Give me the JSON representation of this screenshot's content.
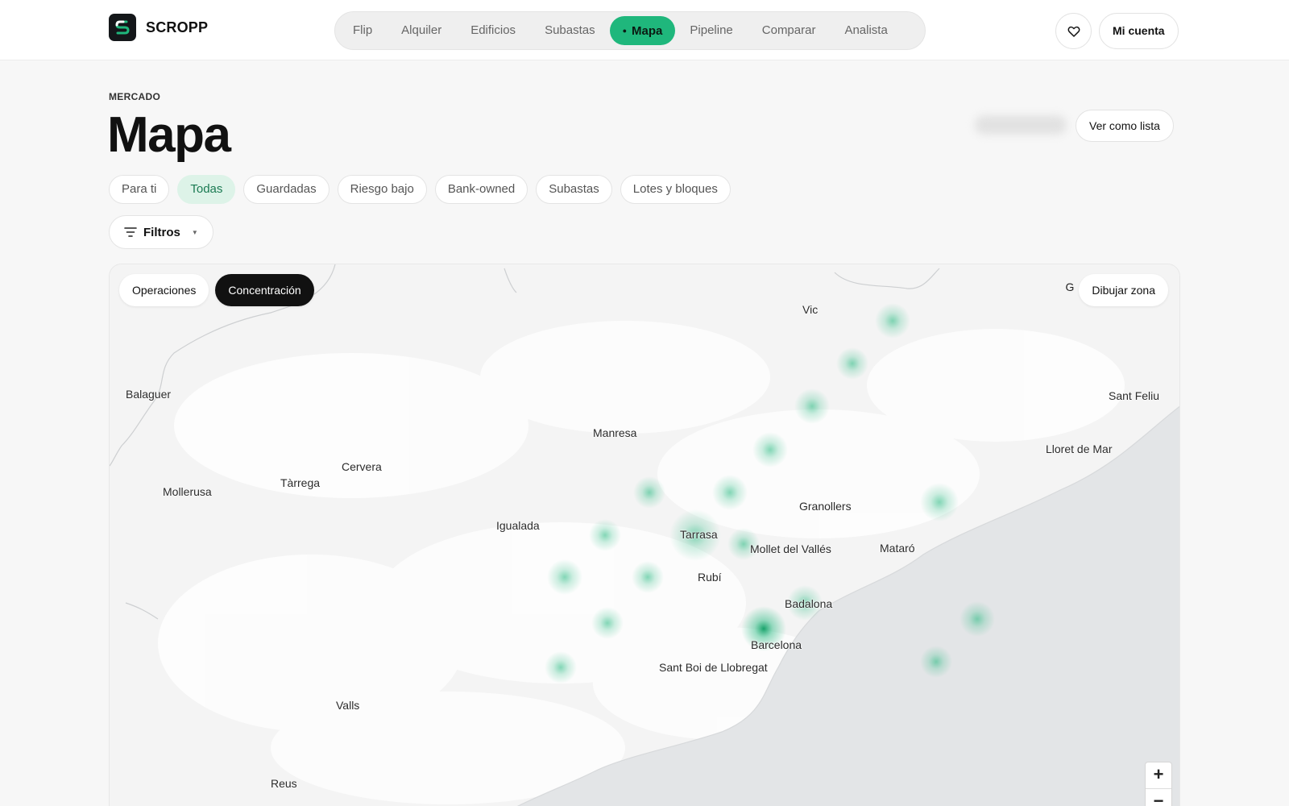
{
  "brand": {
    "name": "SCROPP"
  },
  "nav": {
    "items": [
      "Flip",
      "Alquiler",
      "Edificios",
      "Subastas",
      "Mapa",
      "Pipeline",
      "Comparar",
      "Analista"
    ],
    "active": "Mapa"
  },
  "header": {
    "eyebrow": "MERCADO",
    "title": "Mapa",
    "account_label": "Mi cuenta",
    "list_view_label": "Ver como lista"
  },
  "chips": {
    "items": [
      "Para ti",
      "Todas",
      "Guardadas",
      "Riesgo bajo",
      "Bank-owned",
      "Subastas",
      "Lotes y bloques"
    ],
    "active": "Todas"
  },
  "filters": {
    "label": "Filtros"
  },
  "map": {
    "modes": [
      "Operaciones",
      "Concentración"
    ],
    "active_mode": "Concentración",
    "draw_prefix": "G",
    "draw_label": "Dibujar zona",
    "zoom_in": "+",
    "zoom_out": "−",
    "cities": [
      "Vic",
      "Balaguer",
      "Sant Feliu",
      "Manresa",
      "Lloret de Mar",
      "Cervera",
      "Mollerusa",
      "Tàrrega",
      "Granollers",
      "Igualada",
      "Tarrasa",
      "Mollet del Vallés",
      "Mataró",
      "Rubí",
      "Badalona",
      "Barcelona",
      "Sant Boi de Llobregat",
      "Valls",
      "Reus"
    ]
  },
  "colors": {
    "accent": "#1fb77c",
    "chip_active_bg": "#ddf3e8",
    "sea": "#e3e5e7"
  },
  "icons": {
    "logo": "scropp-logo-icon",
    "favorites": "heart-icon",
    "filters": "filter-lines-icon"
  }
}
